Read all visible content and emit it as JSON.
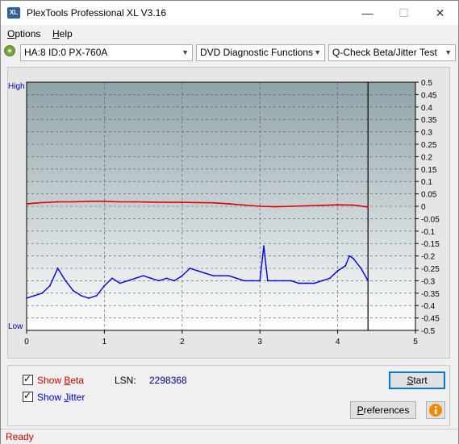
{
  "window": {
    "title": "PlexTools Professional XL V3.16",
    "icon_text": "XL"
  },
  "title_buttons": {
    "minimize": "—",
    "maximize": "☐",
    "close": "✕"
  },
  "menu": [
    {
      "label": "Options",
      "key": "O",
      "rest": "ptions"
    },
    {
      "label": "Help",
      "key": "H",
      "rest": "elp"
    }
  ],
  "toolbar": {
    "drive": "HA:8 ID:0  PX-760A",
    "function": "DVD Diagnostic Functions",
    "test": "Q-Check Beta/Jitter Test"
  },
  "chart_data": {
    "type": "line",
    "left_axis_labels": {
      "top": "High",
      "bottom": "Low"
    },
    "x_ticks": [
      "0",
      "1",
      "2",
      "3",
      "4",
      "5"
    ],
    "xlim": [
      0,
      5
    ],
    "y_ticks": [
      "0.5",
      "0.45",
      "0.4",
      "0.35",
      "0.3",
      "0.25",
      "0.2",
      "0.15",
      "0.1",
      "0.05",
      "0",
      "-0.05",
      "-0.1",
      "-0.15",
      "-0.2",
      "-0.25",
      "-0.3",
      "-0.35",
      "-0.4",
      "-0.45",
      "-0.5"
    ],
    "ylim": [
      -0.5,
      0.5
    ],
    "grid": true,
    "end_marker_x": 4.39,
    "series": [
      {
        "color": "#e00000",
        "x": [
          0,
          0.2,
          0.4,
          0.6,
          0.8,
          1.0,
          1.2,
          1.4,
          1.6,
          1.8,
          2.0,
          2.2,
          2.4,
          2.6,
          2.8,
          3.0,
          3.2,
          3.4,
          3.6,
          3.8,
          4.0,
          4.2,
          4.39
        ],
        "y": [
          0.01,
          0.015,
          0.018,
          0.018,
          0.02,
          0.02,
          0.018,
          0.018,
          0.017,
          0.016,
          0.016,
          0.015,
          0.014,
          0.01,
          0.005,
          0.0,
          -0.002,
          0.0,
          0.002,
          0.004,
          0.006,
          0.005,
          -0.003
        ]
      },
      {
        "color": "#0000e0",
        "x": [
          0,
          0.1,
          0.2,
          0.3,
          0.4,
          0.5,
          0.6,
          0.7,
          0.8,
          0.9,
          1.0,
          1.1,
          1.2,
          1.3,
          1.4,
          1.5,
          1.6,
          1.7,
          1.8,
          1.9,
          2.0,
          2.1,
          2.2,
          2.3,
          2.4,
          2.5,
          2.6,
          2.7,
          2.8,
          2.9,
          3.0,
          3.05,
          3.1,
          3.2,
          3.3,
          3.4,
          3.5,
          3.6,
          3.7,
          3.8,
          3.9,
          4.0,
          4.1,
          4.15,
          4.2,
          4.3,
          4.39
        ],
        "y": [
          -0.37,
          -0.36,
          -0.35,
          -0.32,
          -0.25,
          -0.3,
          -0.34,
          -0.36,
          -0.37,
          -0.36,
          -0.32,
          -0.29,
          -0.31,
          -0.3,
          -0.29,
          -0.28,
          -0.29,
          -0.3,
          -0.29,
          -0.3,
          -0.28,
          -0.25,
          -0.26,
          -0.27,
          -0.28,
          -0.28,
          -0.28,
          -0.29,
          -0.3,
          -0.3,
          -0.3,
          -0.16,
          -0.3,
          -0.3,
          -0.3,
          -0.3,
          -0.31,
          -0.31,
          -0.31,
          -0.3,
          -0.29,
          -0.26,
          -0.24,
          -0.2,
          -0.21,
          -0.25,
          -0.3
        ]
      }
    ]
  },
  "options": {
    "show_beta": {
      "label": "Show Beta",
      "pre": "Show ",
      "key": "B",
      "rest": "eta",
      "checked": true
    },
    "show_jitter": {
      "label": "Show Jitter",
      "pre": "Show ",
      "key": "J",
      "rest": "itter",
      "checked": true
    }
  },
  "lsn": {
    "label": "LSN:",
    "value": "2298368"
  },
  "buttons": {
    "start": {
      "label": "Start",
      "key": "S",
      "rest": "tart"
    },
    "preferences": {
      "label": "Preferences",
      "key": "P",
      "rest": "references"
    },
    "info_icon": "info-icon"
  },
  "status": {
    "text": "Ready",
    "color": "#cc0000"
  },
  "colors": {
    "beta": "#e00000",
    "jitter": "#0000e0",
    "accent": "#0078d7"
  }
}
